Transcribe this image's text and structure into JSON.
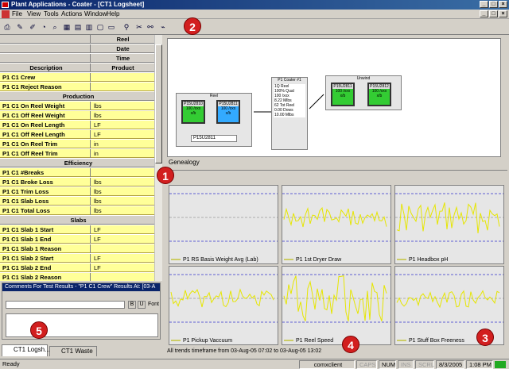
{
  "window": {
    "title": "Plant Applications - Coater - [CT1 Logsheet]"
  },
  "menu": [
    "File",
    "View",
    "Tools",
    "Actions",
    "Window",
    "Help"
  ],
  "grid": {
    "header_rows": [
      "Reel",
      "Date",
      "Time"
    ],
    "col_description": "Description",
    "col_product": "Product",
    "rows": [
      {
        "type": "data",
        "desc": "P1 C1 Crew",
        "unit": ""
      },
      {
        "type": "data",
        "desc": "P1 C1 Reject Reason",
        "unit": ""
      },
      {
        "type": "section",
        "desc": "Production"
      },
      {
        "type": "data",
        "desc": "P1 C1 On Reel Weight",
        "unit": "lbs"
      },
      {
        "type": "data",
        "desc": "P1 C1 Off Reel Weight",
        "unit": "lbs"
      },
      {
        "type": "data",
        "desc": "P1 C1 On Reel Length",
        "unit": "LF"
      },
      {
        "type": "data",
        "desc": "P1 C1 Off Reel Length",
        "unit": "LF"
      },
      {
        "type": "data",
        "desc": "P1 C1 On Reel Trim",
        "unit": "in"
      },
      {
        "type": "data",
        "desc": "P1 C1 Off Reel Trim",
        "unit": "in"
      },
      {
        "type": "section",
        "desc": "Efficiency"
      },
      {
        "type": "data",
        "desc": "P1 C1 #Breaks",
        "unit": ""
      },
      {
        "type": "data",
        "desc": "P1 C1 Broke Loss",
        "unit": "lbs"
      },
      {
        "type": "data",
        "desc": "P1 C1 Trim Loss",
        "unit": "lbs"
      },
      {
        "type": "data",
        "desc": "P1 C1 Slab Loss",
        "unit": "lbs"
      },
      {
        "type": "data",
        "desc": "P1 C1 Total Loss",
        "unit": "lbs"
      },
      {
        "type": "section",
        "desc": "Slabs"
      },
      {
        "type": "data",
        "desc": "P1 C1 Slab 1 Start",
        "unit": "LF"
      },
      {
        "type": "data",
        "desc": "P1 C1 Slab 1 End",
        "unit": "LF"
      },
      {
        "type": "data",
        "desc": "P1 C1 Slab 1 Reason",
        "unit": ""
      },
      {
        "type": "data",
        "desc": "P1 C1 Slab 2 Start",
        "unit": "LF"
      },
      {
        "type": "data",
        "desc": "P1 C1 Slab 2 End",
        "unit": "LF"
      },
      {
        "type": "data",
        "desc": "P1 C1 Slab 2 Reason",
        "unit": ""
      }
    ]
  },
  "comments": {
    "title": "Comments For Test Results - \"P1 C1 Crew\" Results At: [03-A",
    "font_label": "Font"
  },
  "tabs": [
    "CT1 Logsh...",
    "CT1 Waste"
  ],
  "genealogy": {
    "label": "Genealogy",
    "reel_group": "Reel",
    "unwind_group": "Unwind",
    "coater": "P1 Coater #1",
    "reel_units": [
      "P15U2810",
      "P15U2811"
    ],
    "unwind_units": [
      "P15U2811",
      "P15U2812"
    ],
    "unit_value": "100 /xxx",
    "unit_small": "x/b",
    "reel_field": "P15U2811",
    "coater_lines": [
      "1Q Reel",
      "100% Qual",
      "100 /xxx",
      "8.22 Mlbs",
      "62 Tot Reel",
      "0.00 Dows",
      "10.00 Mlbs"
    ]
  },
  "trends": {
    "panels": [
      "P1 RS Basis Weight Avg (Lab)",
      "P1 1st Dryer Draw",
      "P1 Headbox pH",
      "P1 Pickup Vaccuum",
      "P1 Reel Speed",
      "P1 Stuff Box Freeness"
    ],
    "footer": "All trends timeframe from 03-Aug-05 07:02 to 03-Aug-05 13:02"
  },
  "status": {
    "ready": "Ready",
    "server": "comxclient",
    "caps": "CAPS",
    "num": "NUM",
    "ins": "INS",
    "scrl": "SCRL",
    "date": "8/3/2005",
    "time": "1:08 PM"
  },
  "callouts": [
    "1",
    "2",
    "3",
    "4",
    "5"
  ],
  "colors": {
    "data_row": "#ffff99",
    "title_bar": "#0a246a",
    "callout": "#d21f1f"
  }
}
